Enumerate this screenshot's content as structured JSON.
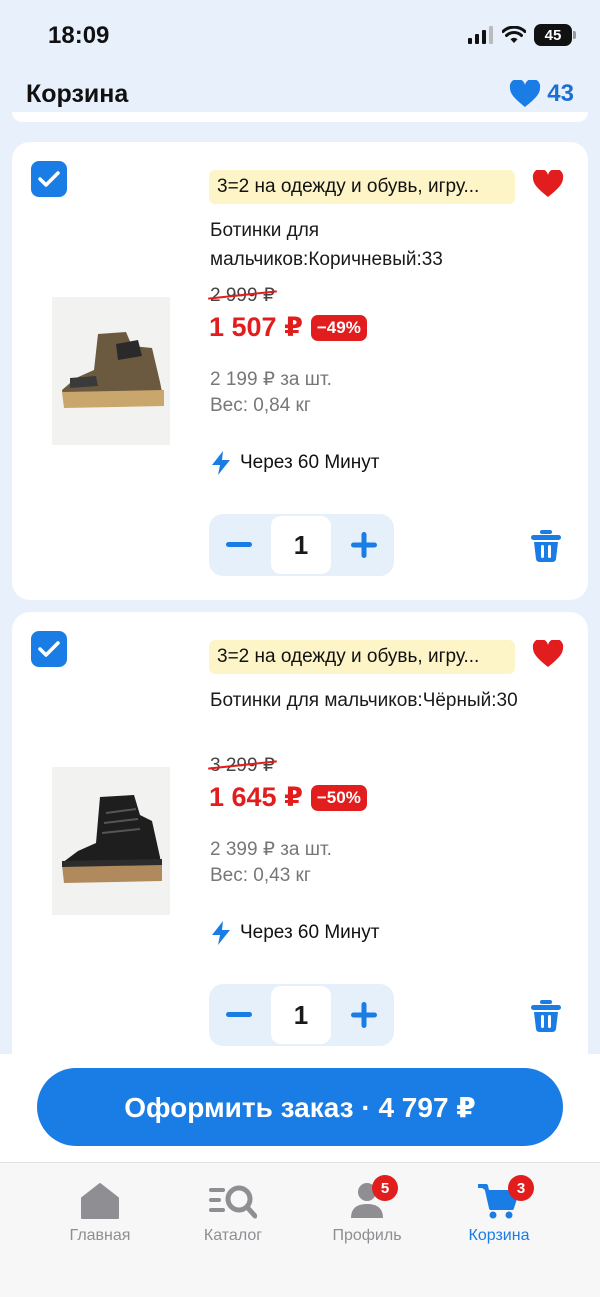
{
  "status_bar": {
    "time": "18:09",
    "battery": "45"
  },
  "header": {
    "title": "Корзина",
    "favorites_count": "43"
  },
  "cart_items": [
    {
      "checked": true,
      "promo": "3=2 на одежду и обувь, игру...",
      "name": "Ботинки для мальчиков:Коричневый:33",
      "old_price": "2 999 ₽",
      "price": "1 507 ₽",
      "discount": "−49%",
      "unit_price": "2 199 ₽ за шт.",
      "weight": "Вес: 0,84 кг",
      "delivery": "Через 60 Минут",
      "quantity": "1"
    },
    {
      "checked": true,
      "promo": "3=2 на одежду и обувь, игру...",
      "name": "Ботинки для мальчиков:Чёрный:30",
      "old_price": "3 299 ₽",
      "price": "1 645 ₽",
      "discount": "−50%",
      "unit_price": "2 399 ₽ за шт.",
      "weight": "Вес: 0,43 кг",
      "delivery": "Через 60 Минут",
      "quantity": "1"
    }
  ],
  "checkout": {
    "label": "Оформить заказ · 4 797 ₽"
  },
  "tabbar": {
    "items": [
      {
        "label": "Главная",
        "icon": "home-icon",
        "badge": ""
      },
      {
        "label": "Каталог",
        "icon": "catalog-search-icon",
        "badge": ""
      },
      {
        "label": "Профиль",
        "icon": "profile-icon",
        "badge": "5"
      },
      {
        "label": "Корзина",
        "icon": "cart-icon",
        "badge": "3"
      }
    ],
    "active": "Корзина"
  },
  "colors": {
    "accent": "#1a7de6",
    "sale": "#e21d1d",
    "promo_bg": "#fdf5c8"
  }
}
